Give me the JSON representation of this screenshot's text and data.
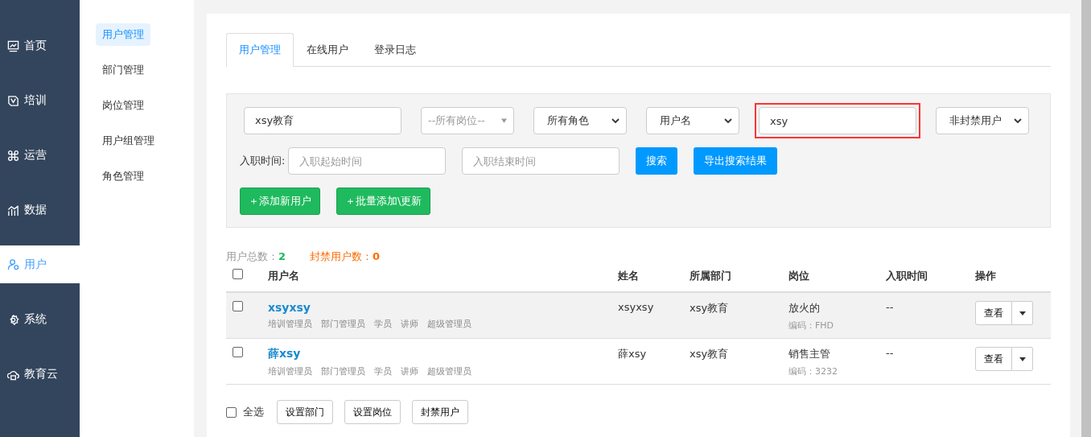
{
  "nav": [
    {
      "label": "首页",
      "selected": false
    },
    {
      "label": "培训",
      "selected": false
    },
    {
      "label": "运营",
      "selected": false
    },
    {
      "label": "数据",
      "selected": false
    },
    {
      "label": "用户",
      "selected": true
    },
    {
      "label": "系统",
      "selected": false
    },
    {
      "label": "教育云",
      "selected": false
    }
  ],
  "submenu": [
    {
      "label": "用户管理",
      "selected": true
    },
    {
      "label": "部门管理",
      "selected": false
    },
    {
      "label": "岗位管理",
      "selected": false
    },
    {
      "label": "用户组管理",
      "selected": false
    },
    {
      "label": "角色管理",
      "selected": false
    }
  ],
  "tabs": [
    {
      "label": "用户管理",
      "selected": true
    },
    {
      "label": "在线用户",
      "selected": false
    },
    {
      "label": "登录日志",
      "selected": false
    }
  ],
  "filters": [
    {
      "kind": "input",
      "value": "xsy教育",
      "highlighted": false
    },
    {
      "kind": "select",
      "value": "--所有岗位--",
      "disabled": true,
      "highlighted": false
    },
    {
      "kind": "select",
      "value": "所有角色",
      "disabled": false,
      "highlighted": false
    },
    {
      "kind": "select",
      "value": "用户名",
      "disabled": false,
      "highlighted": false
    },
    {
      "kind": "input",
      "value": "xsy",
      "highlighted": true
    },
    {
      "kind": "select",
      "value": "非封禁用户",
      "disabled": false,
      "highlighted": false
    }
  ],
  "date_filter": {
    "label": "入职时间:",
    "start_placeholder": "入职起始时间",
    "end_placeholder": "入职结束时间"
  },
  "search_buttons": [
    "搜索",
    "导出搜索结果"
  ],
  "add_buttons": [
    "＋添加新用户",
    "＋批量添加\\更新"
  ],
  "stats": [
    {
      "label": "用户总数：",
      "value": "2",
      "kind": "total"
    },
    {
      "label": "封禁用户数：",
      "value": "0",
      "kind": "banned"
    }
  ],
  "table": {
    "columns": [
      "用户名",
      "姓名",
      "所属部门",
      "岗位",
      "入职时间",
      "操作"
    ],
    "header_checked": false,
    "rows": [
      {
        "checked": false,
        "highlighted": true,
        "username": "xsyxsy",
        "roles": [
          "培训管理员",
          "部门管理员",
          "学员",
          "讲师",
          "超级管理员"
        ],
        "name": "xsyxsy",
        "department": "xsy教育",
        "post": "放火的",
        "post_code": "编码：FHD",
        "hire_date": "--",
        "action": "查看"
      },
      {
        "checked": false,
        "highlighted": false,
        "username": "薛xsy",
        "roles": [
          "培训管理员",
          "部门管理员",
          "学员",
          "讲师",
          "超级管理员"
        ],
        "name": "薛xsy",
        "department": "xsy教育",
        "post": "销售主管",
        "post_code": "编码：3232",
        "hire_date": "--",
        "action": "查看"
      }
    ]
  },
  "bulk": {
    "select_all": {
      "label": "全选",
      "checked": false
    },
    "buttons": [
      "设置部门",
      "设置岗位",
      "封禁用户"
    ]
  }
}
